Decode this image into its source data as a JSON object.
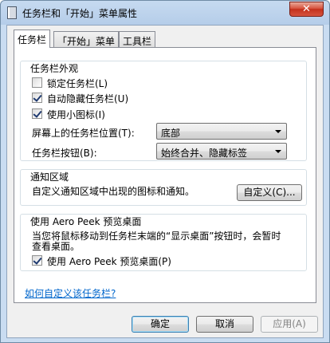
{
  "window": {
    "title": "任务栏和「开始」菜单属性",
    "close_label": "✕"
  },
  "tabs": [
    {
      "label": "任务栏"
    },
    {
      "label": "「开始」菜单"
    },
    {
      "label": "工具栏"
    }
  ],
  "appearance": {
    "title": "任务栏外观",
    "lock": {
      "label": "锁定任务栏(L)",
      "checked": false
    },
    "autohide": {
      "label": "自动隐藏任务栏(U)",
      "checked": true
    },
    "small_icons": {
      "label": "使用小图标(I)",
      "checked": true
    },
    "location": {
      "label": "屏幕上的任务栏位置(T):",
      "value": "底部"
    },
    "buttons": {
      "label": "任务栏按钮(B):",
      "value": "始终合并、隐藏标签"
    }
  },
  "notification": {
    "title": "通知区域",
    "text": "自定义通知区域中出现的图标和通知。",
    "customize_label": "自定义(C)..."
  },
  "aero_peek": {
    "title": "使用 Aero Peek 预览桌面",
    "desc_line1": "当您将鼠标移动到任务栏末端的“显示桌面”按钮时，会暂时",
    "desc_line2": "查看桌面。",
    "checkbox": {
      "label": "使用 Aero Peek 预览桌面(P)",
      "checked": true
    }
  },
  "help_link": "如何自定义该任务栏?",
  "footer": {
    "ok_label": "确定",
    "cancel_label": "取消",
    "apply_label": "应用(A)"
  }
}
